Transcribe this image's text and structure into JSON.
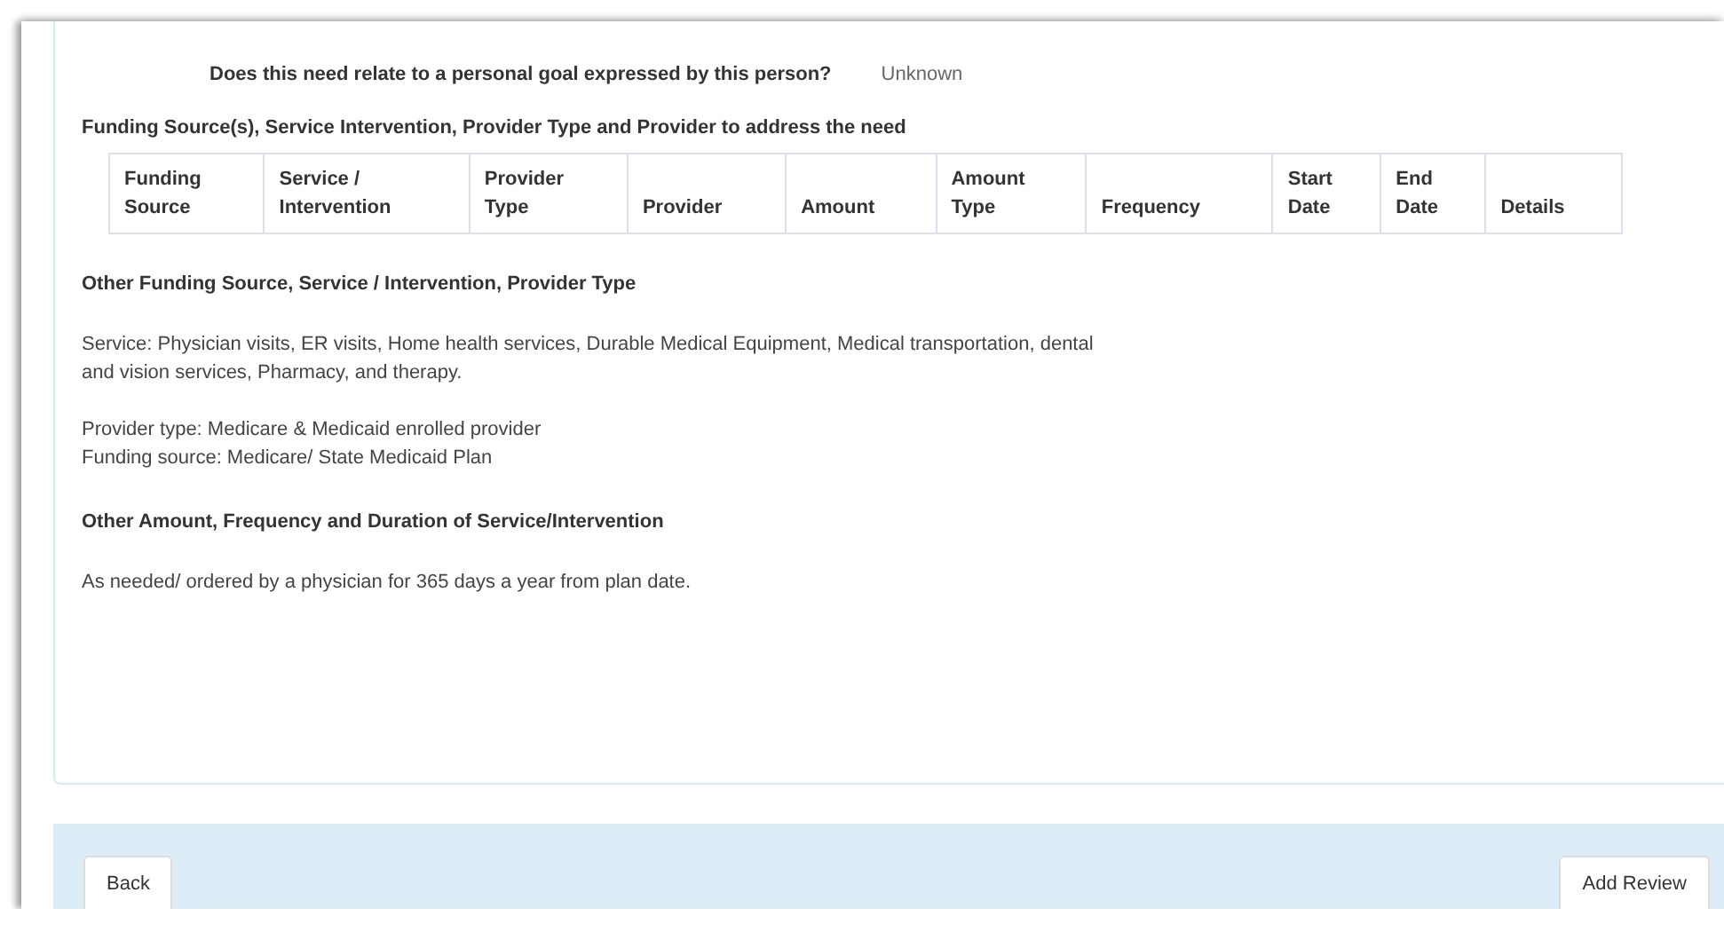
{
  "goal_question": {
    "label": "Does this need relate to a personal goal expressed by this person?",
    "value": "Unknown"
  },
  "funding_heading": "Funding Source(s), Service Intervention, Provider Type and Provider to address the need",
  "table": {
    "columns": [
      [
        "Funding",
        "Source"
      ],
      [
        "Service /",
        "Intervention"
      ],
      [
        "Provider",
        "Type"
      ],
      [
        "",
        "Provider"
      ],
      [
        "",
        "Amount"
      ],
      [
        "Amount",
        "Type"
      ],
      [
        "",
        "Frequency"
      ],
      [
        "Start",
        "Date"
      ],
      [
        "End",
        "Date"
      ],
      [
        "",
        "Details"
      ]
    ]
  },
  "other_funding": {
    "heading": "Other Funding Source, Service / Intervention, Provider Type",
    "paragraphs": [
      [
        "Service: Physician visits, ER visits, Home health services, Durable Medical Equipment, Medical transportation, dental",
        "and vision services, Pharmacy, and therapy."
      ],
      [
        "Provider type: Medicare & Medicaid enrolled provider",
        "Funding source: Medicare/ State Medicaid Plan"
      ]
    ]
  },
  "other_amount": {
    "heading": "Other Amount, Frequency and Duration of Service/Intervention",
    "paragraphs": [
      [
        "As needed/ ordered by a physician for 365 days a year from plan date."
      ]
    ]
  },
  "buttons": [
    "Back",
    "Add Review"
  ]
}
